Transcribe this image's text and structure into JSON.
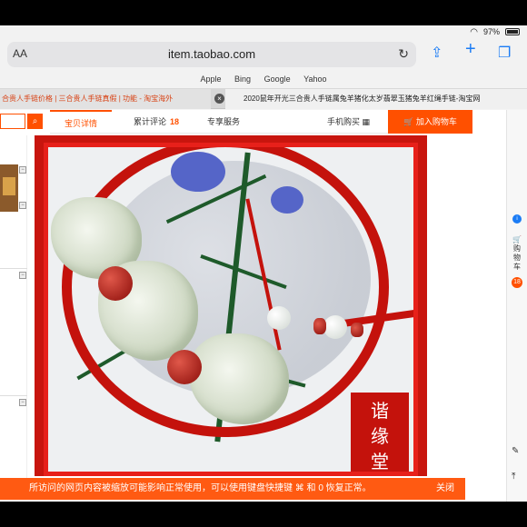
{
  "status": {
    "battery": "97%"
  },
  "browser": {
    "aa_label": "AA",
    "url": "item.taobao.com",
    "favorites": [
      "Apple",
      "Bing",
      "Google",
      "Yahoo"
    ],
    "tabs": [
      {
        "title": "合贵人手链价格 | 三合贵人手链真假 | 功能 - 淘宝海外"
      },
      {
        "title": "2020鼠年开光三合贵人手链属兔羊猪化太岁翡翠玉猪兔羊红绳手链-淘宝网"
      }
    ]
  },
  "page": {
    "tabs": {
      "details": "宝贝详情",
      "reviews": "累计评论",
      "reviews_count": "18",
      "service": "专享服务",
      "mobile": "手机购买"
    },
    "add_to_cart": "加入购物车",
    "seal_text": [
      "谐",
      "缘",
      "堂"
    ]
  },
  "sidebar_right": {
    "cart_label": "购物车",
    "cart_count": "18"
  },
  "notice": {
    "text": "所访问的网页内容被缩放可能影响正常使用，可以使用键盘快捷键 ⌘ 和 0 恢复正常。",
    "close": "关闭"
  }
}
